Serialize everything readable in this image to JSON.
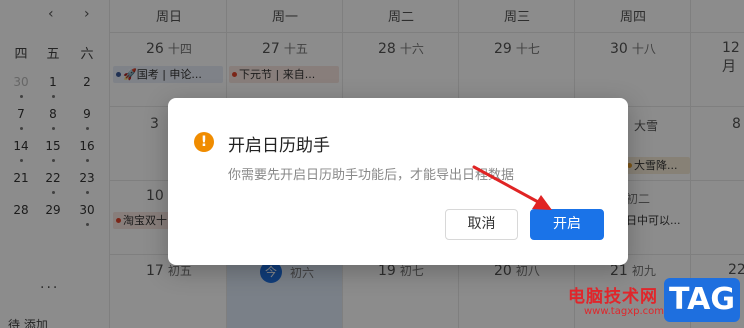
{
  "mini_calendar": {
    "prev": "‹",
    "next": "›",
    "weekdays": [
      "四",
      "五",
      "六"
    ],
    "rows": [
      [
        "30",
        "1",
        "2"
      ],
      [
        "7",
        "8",
        "9"
      ],
      [
        "14",
        "15",
        "16"
      ],
      [
        "21",
        "22",
        "23"
      ],
      [
        "28",
        "29",
        "30"
      ]
    ],
    "more": "···",
    "remind_label": "待 添加"
  },
  "week_view": {
    "headers": [
      "周日",
      "周一",
      "周二",
      "周三",
      "周四",
      "12月"
    ],
    "header_today_partial": "周四",
    "row1": [
      {
        "day": "26",
        "lunar": "十四"
      },
      {
        "day": "27",
        "lunar": "十五"
      },
      {
        "day": "28",
        "lunar": "十六"
      },
      {
        "day": "29",
        "lunar": "十七"
      },
      {
        "day": "30",
        "lunar": "十八"
      },
      {
        "day": "12月",
        "lunar": ""
      }
    ],
    "row2_days": [
      "3",
      "大雪",
      "8"
    ],
    "row3": [
      {
        "day": "10",
        "lunar": ""
      },
      {
        "day": "",
        "lunar": "初二"
      }
    ],
    "row4": [
      {
        "day": "17",
        "lunar": "初五"
      },
      {
        "day": "今",
        "lunar": "初六"
      },
      {
        "day": "19",
        "lunar": "初七"
      },
      {
        "day": "20",
        "lunar": "初八"
      },
      {
        "day": "21",
        "lunar": "初九"
      },
      {
        "day": "22",
        "lunar": ""
      }
    ],
    "events": {
      "guokao": "🚀国考 | 申论...",
      "xiayuan": "下元节 | 来自...",
      "daxue": "大雪降...",
      "taobao": "淘宝双十",
      "sunday_event": "日中可以..."
    }
  },
  "dialog": {
    "title": "开启日历助手",
    "message": "你需要先开启日历助手功能后，才能导出日程数据",
    "cancel_label": "取消",
    "confirm_label": "开启",
    "icon": "warning-icon"
  },
  "watermark": {
    "text": "电脑技术网",
    "url": "www.tagxp.com",
    "tag": "TAG"
  },
  "colors": {
    "primary": "#1a73e8",
    "warning": "#f08c00",
    "arrow": "#e02424"
  }
}
